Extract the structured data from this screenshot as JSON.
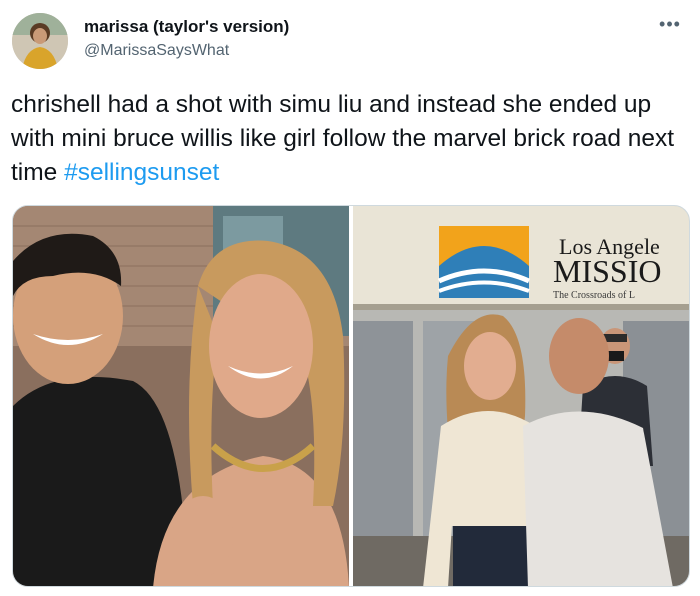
{
  "tweet": {
    "display_name": "marissa (taylor's version)",
    "handle": "@MarissaSaysWhat",
    "more_icon": "more-horizontal-icon",
    "text": "chrishell had a shot with simu liu and instead she ended up with mini bruce willis like girl follow the marvel brick road next time ",
    "hashtag": "#sellingsunset"
  },
  "media": {
    "right_photo": {
      "sign_line1": "Los Angele",
      "sign_line2": "MISSIO",
      "sign_tagline": "The Crossroads of L"
    }
  },
  "colors": {
    "link": "#1d9bf0",
    "text": "#0f1419",
    "secondary": "#536471",
    "border": "#cfd9de"
  }
}
